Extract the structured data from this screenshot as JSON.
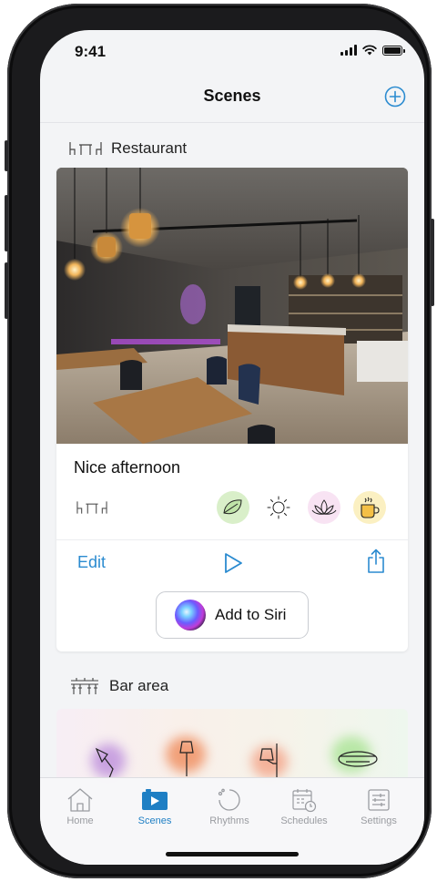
{
  "status_bar": {
    "time": "9:41"
  },
  "nav": {
    "title": "Scenes",
    "add_icon": "plus-circle-icon"
  },
  "sections": [
    {
      "title": "Restaurant",
      "icon": "restaurant-table-icon"
    },
    {
      "title": "Bar area",
      "icon": "bar-counter-icon"
    }
  ],
  "scene_card": {
    "name": "Nice afternoon",
    "image": "restaurant-interior-photo",
    "room_icon": "restaurant-table-icon",
    "moods": [
      {
        "icon": "leaves-icon",
        "color": "#d9efc9"
      },
      {
        "icon": "sun-icon",
        "color": "#ffffff"
      },
      {
        "icon": "lotus-icon",
        "color": "#f8e3f3"
      },
      {
        "icon": "coffee-cup-icon",
        "color": "#fbf0c2"
      }
    ],
    "edit_label": "Edit",
    "siri_label": "Add to Siri",
    "accent": "#2b8bd0"
  },
  "tabs": [
    {
      "label": "Home",
      "icon": "home-icon",
      "active": false
    },
    {
      "label": "Scenes",
      "icon": "scenes-icon",
      "active": true
    },
    {
      "label": "Rhythms",
      "icon": "rhythms-icon",
      "active": false
    },
    {
      "label": "Schedules",
      "icon": "schedules-icon",
      "active": false
    },
    {
      "label": "Settings",
      "icon": "settings-icon",
      "active": false
    }
  ]
}
